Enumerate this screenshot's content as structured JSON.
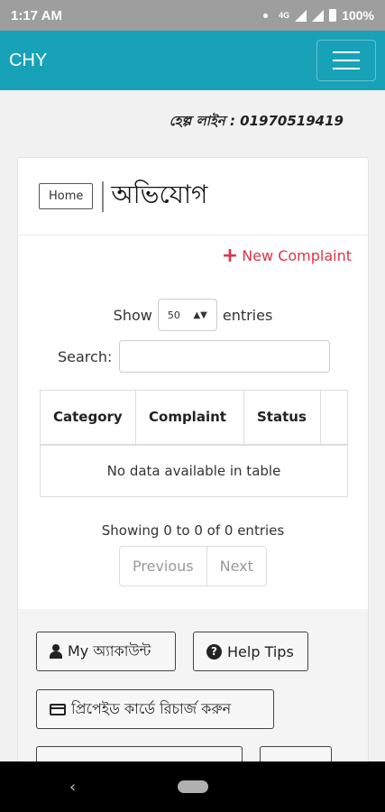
{
  "status_bar": {
    "time": "1:17 AM",
    "network": "4G",
    "battery": "100%"
  },
  "navbar": {
    "brand": "CHY"
  },
  "helpline": "হেল্প লাইন : 01970519419",
  "header": {
    "home_label": "Home",
    "title": "অভিযোগ"
  },
  "new_complaint_label": "New Complaint",
  "table_controls": {
    "show_label": "Show",
    "entries_value": "50",
    "entries_label": "entries",
    "search_label": "Search:",
    "search_value": ""
  },
  "table": {
    "columns": [
      "Category",
      "Complaint",
      "Status",
      ""
    ],
    "empty_message": "No data available in table"
  },
  "info": "Showing 0 to 0 of 0 entries",
  "pagination": {
    "previous": "Previous",
    "next": "Next"
  },
  "buttons": {
    "my_account": "My অ্যাকাউন্ট",
    "help_tips": "Help Tips",
    "recharge": "প্রিপেইড কার্ডে রিচার্জ করুন"
  },
  "icons": {
    "menu": "hamburger-icon",
    "plus": "plus-icon",
    "user": "user-icon",
    "help": "question-circle-icon",
    "card": "credit-card-icon"
  },
  "colors": {
    "navbar": "#17a2b8",
    "accent_red": "#dc3545"
  }
}
